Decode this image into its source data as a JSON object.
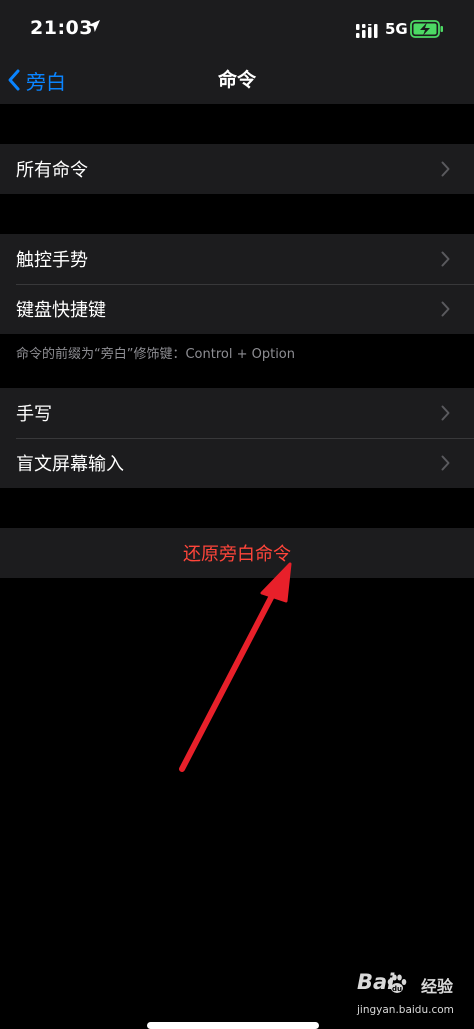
{
  "status_bar": {
    "time": "21:03",
    "network": "5G",
    "location_icon": "location-arrow-icon",
    "signal_icon": "cellular-signal-icon",
    "battery_icon": "battery-charging-icon"
  },
  "nav": {
    "back_label": "旁白",
    "title": "命令"
  },
  "groups": [
    {
      "items": [
        {
          "label": "所有命令"
        }
      ]
    },
    {
      "items": [
        {
          "label": "触控手势"
        },
        {
          "label": "键盘快捷键"
        }
      ],
      "footer": "命令的前缀为“旁白”修饰键：Control + Option"
    },
    {
      "items": [
        {
          "label": "手写"
        },
        {
          "label": "盲文屏幕输入"
        }
      ]
    }
  ],
  "reset": {
    "label": "还原旁白命令"
  },
  "watermark": {
    "brand": "Bai",
    "brand2": "经验",
    "url": "jingyan.baidu.com"
  },
  "colors": {
    "background": "#000000",
    "group_bg": "#1c1c1e",
    "accent": "#0a84ff",
    "destructive": "#ff453a",
    "annotation_arrow": "#e8202a",
    "battery_green": "#4cd964"
  }
}
